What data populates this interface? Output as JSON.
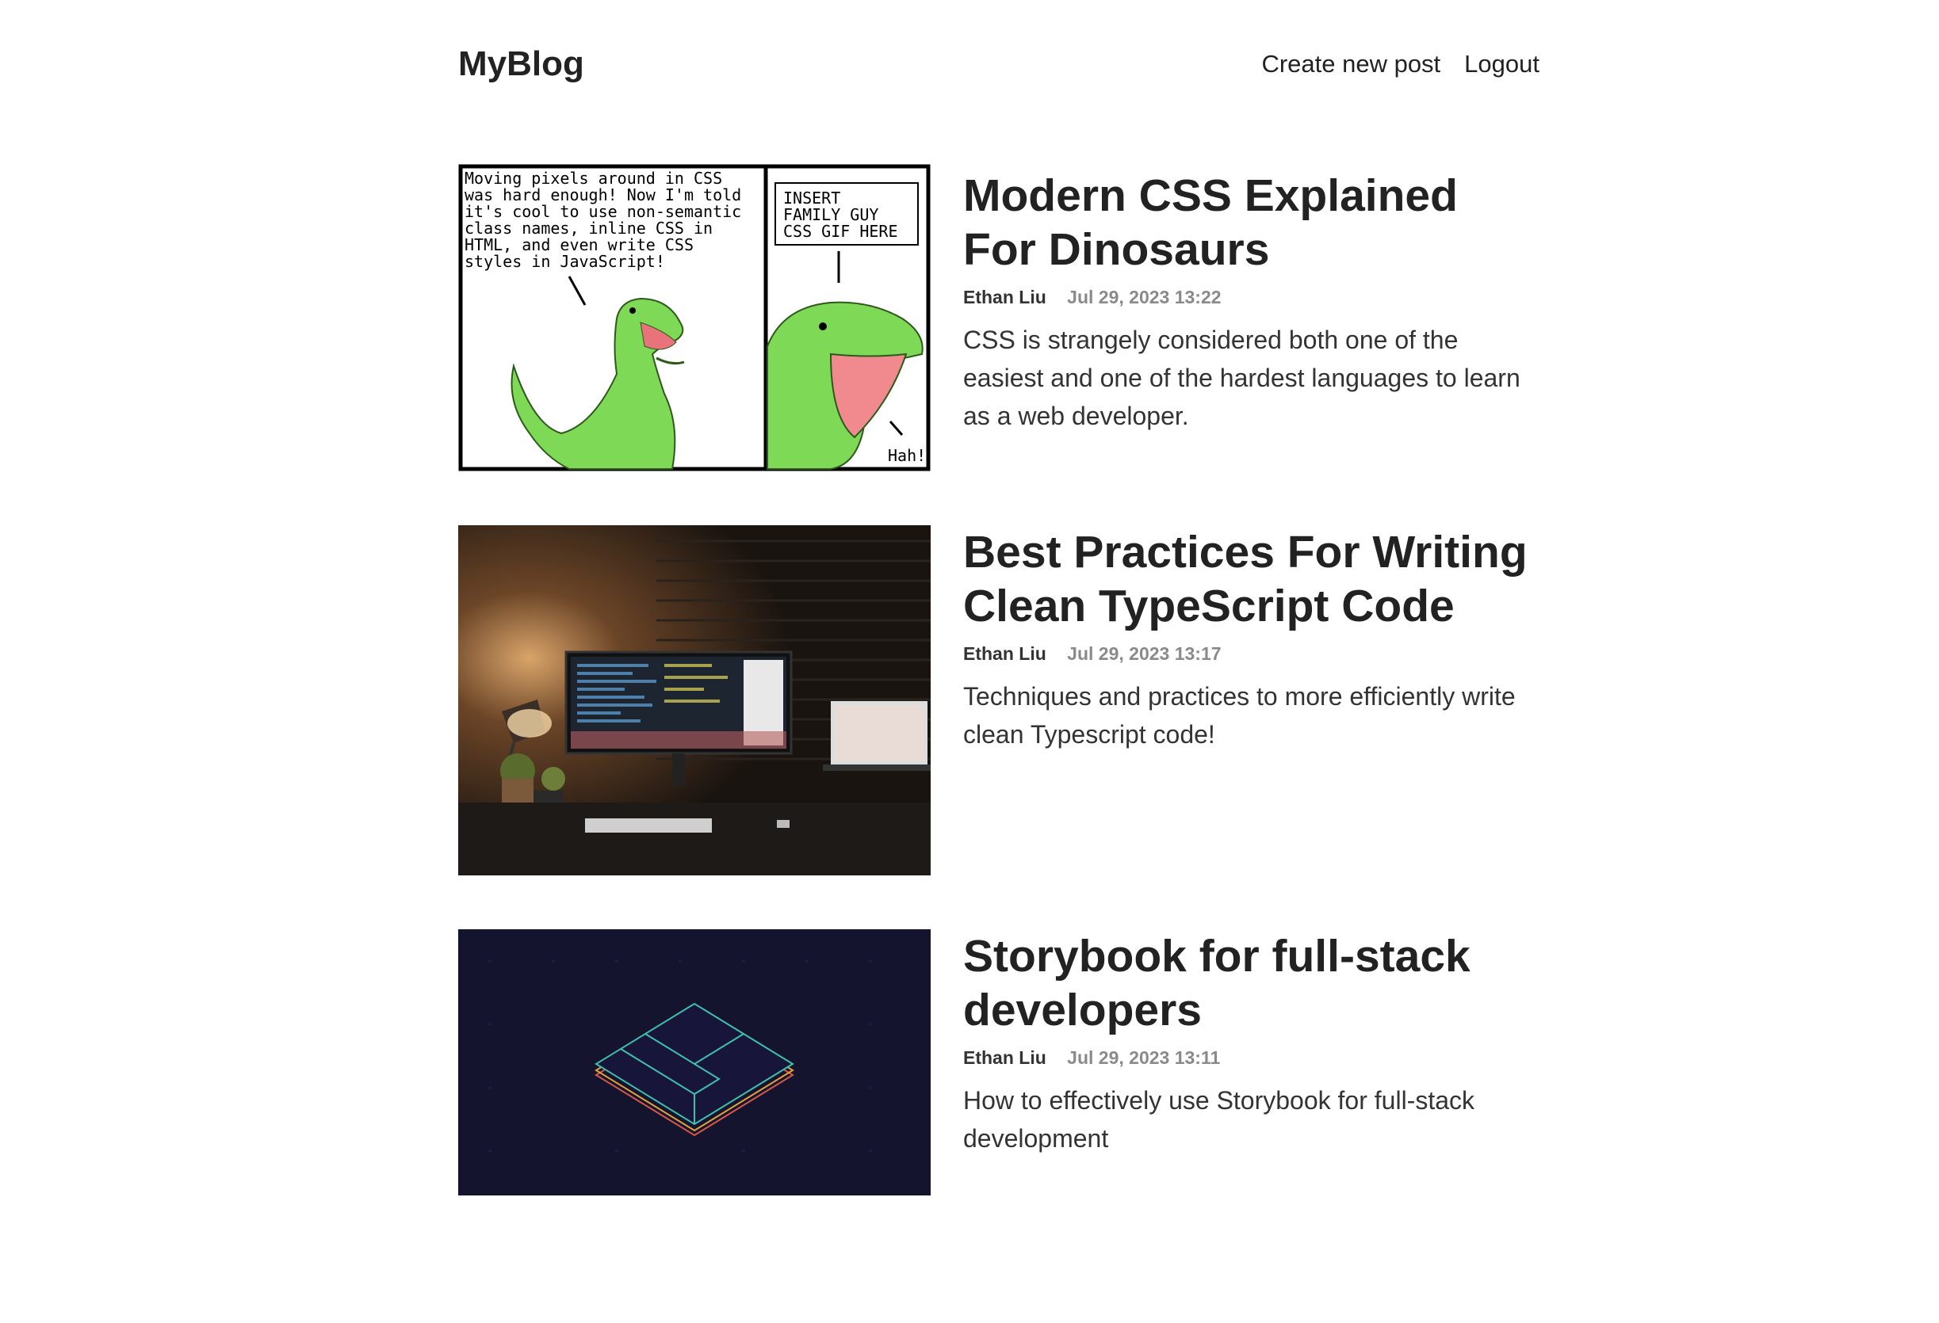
{
  "header": {
    "logo": "MyBlog",
    "nav": [
      "Create new post",
      "Logout"
    ]
  },
  "posts": [
    {
      "title": "Modern CSS Explained For Dinosaurs",
      "author": "Ethan Liu",
      "date": "Jul 29, 2023 13:22",
      "excerpt": "CSS is strangely considered both one of the easiest and one of the hardest languages to learn as a web developer.",
      "image": {
        "type": "comic",
        "panel1_text": [
          "Moving pixels around in CSS",
          "was hard enough! Now I'm told",
          "it's cool to use non-semantic",
          "class names, inline CSS in",
          "HTML, and even write CSS",
          "styles in JavaScript!"
        ],
        "panel2_box": [
          "INSERT",
          "FAMILY GUY",
          "CSS GIF HERE"
        ],
        "panel2_exclaim": "Hah!"
      }
    },
    {
      "title": "Best Practices For Writing Clean TypeScript Code",
      "author": "Ethan Liu",
      "date": "Jul 29, 2023 13:17",
      "excerpt": "Techniques and practices to more efficiently write clean Typescript code!",
      "image": {
        "type": "desk-photo"
      }
    },
    {
      "title": "Storybook for full-stack developers",
      "author": "Ethan Liu",
      "date": "Jul 29, 2023 13:11",
      "excerpt": "How to effectively use Storybook for full-stack development",
      "image": {
        "type": "storybook-graphic"
      }
    }
  ],
  "colors": {
    "text": "#222222",
    "meta": "#8a8a8a",
    "dino_green": "#7ed957",
    "storybook_bg": "#15142e"
  }
}
